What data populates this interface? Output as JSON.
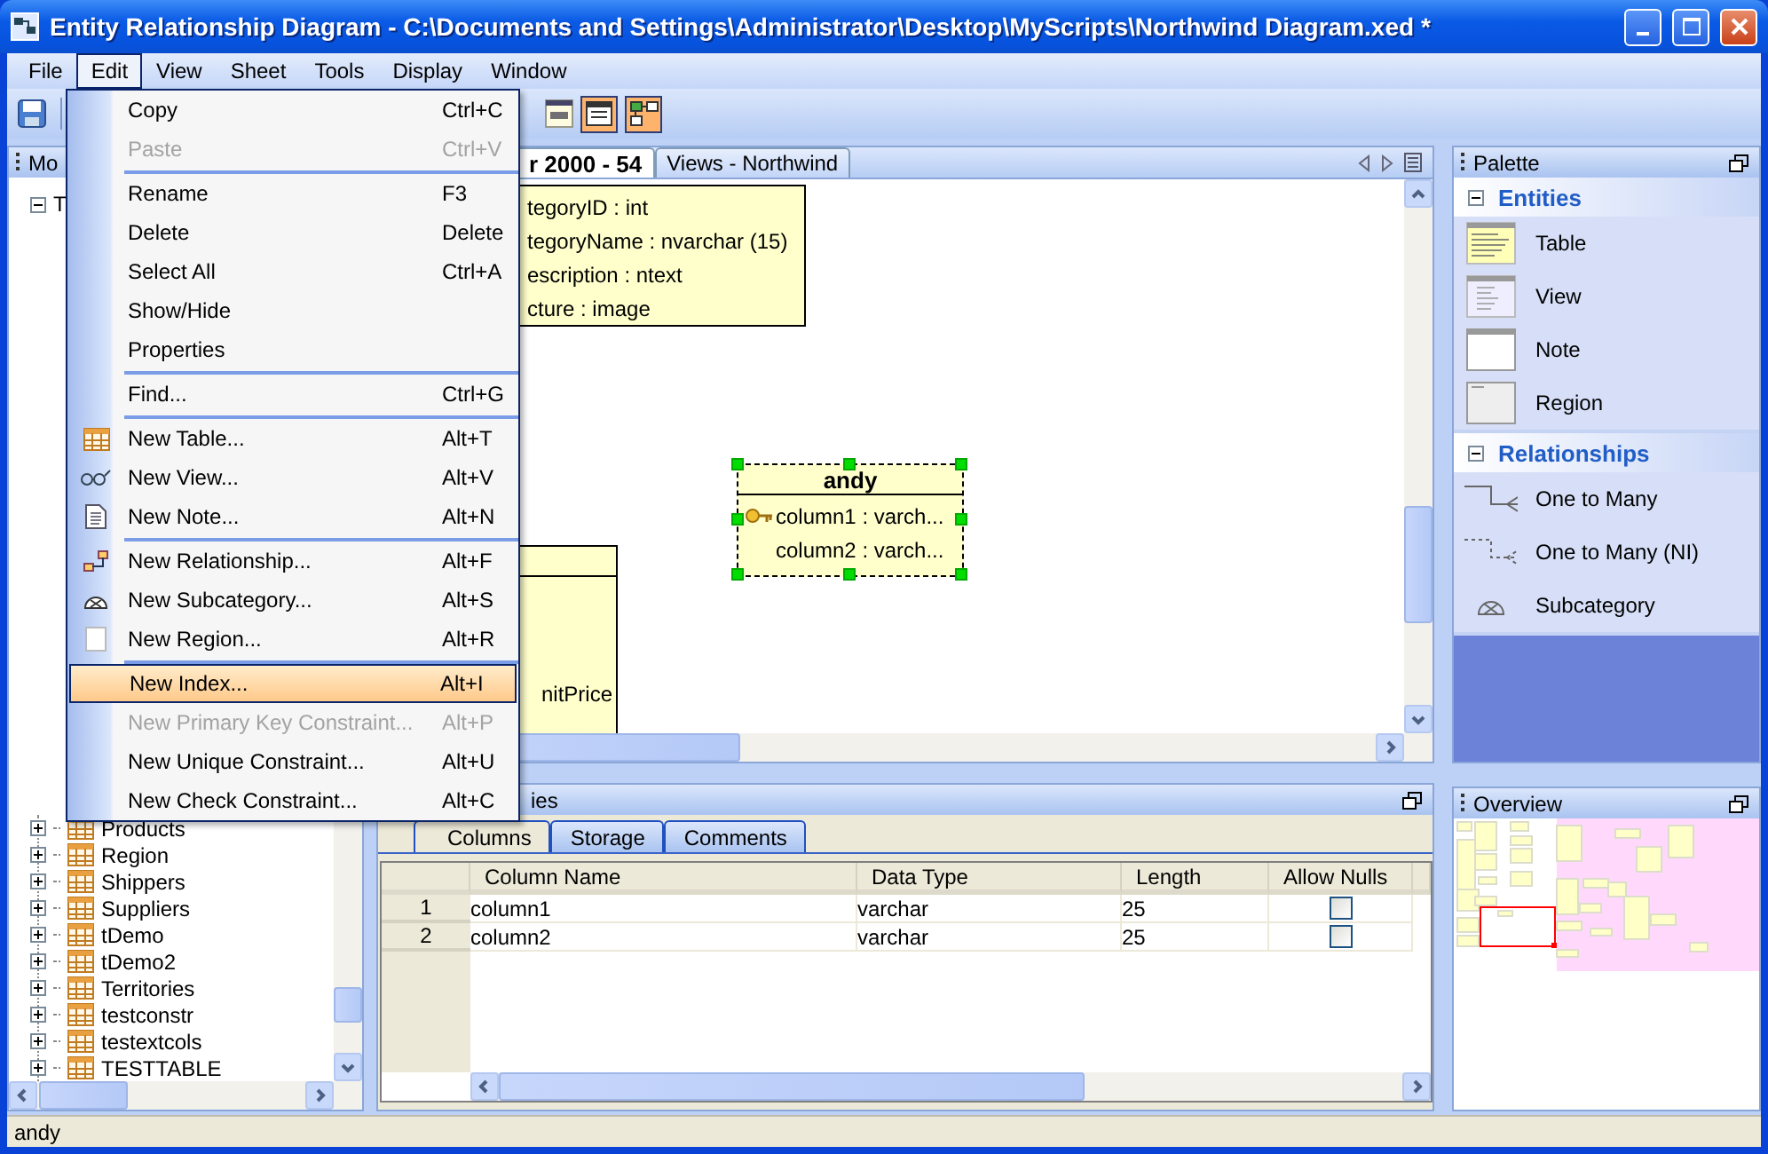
{
  "window": {
    "title": "Entity Relationship Diagram - C:\\Documents and Settings\\Administrator\\Desktop\\MyScripts\\Northwind Diagram.xed *"
  },
  "menubar": [
    {
      "label": "File",
      "selected": false
    },
    {
      "label": "Edit",
      "selected": true
    },
    {
      "label": "View",
      "selected": false
    },
    {
      "label": "Sheet",
      "selected": false
    },
    {
      "label": "Tools",
      "selected": false
    },
    {
      "label": "Display",
      "selected": false
    },
    {
      "label": "Window",
      "selected": false
    }
  ],
  "toolbar": {
    "toggles": [
      {
        "pressed": true
      },
      {
        "pressed": true
      }
    ]
  },
  "edit_menu": [
    {
      "kind": "plain",
      "label": "Copy",
      "shortcut": "Ctrl+C",
      "disabled": false,
      "selected": false
    },
    {
      "kind": "plain",
      "label": "Paste",
      "shortcut": "Ctrl+V",
      "disabled": true,
      "selected": false
    },
    {
      "kind": "separator"
    },
    {
      "kind": "plain",
      "label": "Rename",
      "shortcut": "F3",
      "disabled": false,
      "selected": false
    },
    {
      "kind": "plain",
      "label": "Delete",
      "shortcut": "Delete",
      "disabled": false,
      "selected": false
    },
    {
      "kind": "plain",
      "label": "Select All",
      "shortcut": "Ctrl+A",
      "disabled": false,
      "selected": false
    },
    {
      "kind": "plain",
      "label": "Show/Hide",
      "disabled": false,
      "selected": false
    },
    {
      "kind": "plain",
      "label": "Properties",
      "disabled": false,
      "selected": false
    },
    {
      "kind": "separator"
    },
    {
      "kind": "plain",
      "label": "Find...",
      "shortcut": "Ctrl+G",
      "disabled": false,
      "selected": false
    },
    {
      "kind": "separator"
    },
    {
      "kind": "table",
      "label": "New Table...",
      "shortcut": "Alt+T",
      "disabled": false,
      "selected": false
    },
    {
      "kind": "view",
      "label": "New View...",
      "shortcut": "Alt+V",
      "disabled": false,
      "selected": false
    },
    {
      "kind": "note",
      "label": "New Note...",
      "shortcut": "Alt+N",
      "disabled": false,
      "selected": false
    },
    {
      "kind": "separator"
    },
    {
      "kind": "relationship",
      "label": "New Relationship...",
      "shortcut": "Alt+F",
      "disabled": false,
      "selected": false
    },
    {
      "kind": "subcategory",
      "label": "New Subcategory...",
      "shortcut": "Alt+S",
      "disabled": false,
      "selected": false
    },
    {
      "kind": "region",
      "label": "New Region...",
      "shortcut": "Alt+R",
      "disabled": false,
      "selected": false
    },
    {
      "kind": "separator"
    },
    {
      "kind": "plain",
      "label": "New Index...",
      "shortcut": "Alt+I",
      "disabled": false,
      "selected": true
    },
    {
      "kind": "plain",
      "label": "New Primary Key Constraint...",
      "shortcut": "Alt+P",
      "disabled": true,
      "selected": false
    },
    {
      "kind": "plain",
      "label": "New Unique Constraint...",
      "shortcut": "Alt+U",
      "disabled": false,
      "selected": false
    },
    {
      "kind": "plain",
      "label": "New Check Constraint...",
      "shortcut": "Alt+C",
      "disabled": false,
      "selected": false
    }
  ],
  "model_panel": {
    "title": "Mo",
    "tree": {
      "label": "T",
      "expanded": true,
      "children": [
        {
          "label": "Products",
          "expanded": false
        },
        {
          "label": "Region",
          "expanded": false
        },
        {
          "label": "Shippers",
          "expanded": false
        },
        {
          "label": "Suppliers",
          "expanded": false
        },
        {
          "label": "tDemo",
          "expanded": false
        },
        {
          "label": "tDemo2",
          "expanded": false
        },
        {
          "label": "Territories",
          "expanded": false
        },
        {
          "label": "testconstr",
          "expanded": false
        },
        {
          "label": "testextcols",
          "expanded": false
        },
        {
          "label": "TESTTABLE",
          "expanded": false
        }
      ]
    }
  },
  "diagram": {
    "tabs": [
      {
        "label": "r 2000 - 54",
        "selected": true
      },
      {
        "label": "Views - Northwind",
        "selected": false
      }
    ],
    "entities": [
      {
        "selected": false,
        "columns": [
          {
            "text": "tegoryID : int",
            "key": false
          },
          {
            "text": "tegoryName : nvarchar (15)",
            "key": false
          },
          {
            "text": "escription : ntext",
            "key": false
          },
          {
            "text": "cture : image",
            "key": false
          }
        ]
      },
      {
        "selected": false,
        "columns": [
          {
            "text": "nitPrice",
            "key": false
          }
        ]
      },
      {
        "name": "andy",
        "selected": true,
        "columns": [
          {
            "text": "column1 : varch...",
            "key": true
          },
          {
            "text": "column2 : varch...",
            "key": false
          }
        ]
      }
    ]
  },
  "properties_panel": {
    "title": "ies",
    "tabs": [
      {
        "label": "Columns",
        "selected": true
      },
      {
        "label": "Storage",
        "selected": false
      },
      {
        "label": "Comments",
        "selected": false
      }
    ],
    "columns": [
      "Column Name",
      "Data Type",
      "Length",
      "Allow Nulls"
    ],
    "rows": [
      {
        "number": "1",
        "name": "column1",
        "type": "varchar",
        "length": "25",
        "allow_nulls": false
      },
      {
        "number": "2",
        "name": "column2",
        "type": "varchar",
        "length": "25",
        "allow_nulls": false
      }
    ]
  },
  "palette": {
    "title": "Palette",
    "sections": [
      {
        "title": "Entities",
        "expanded": true,
        "items": [
          {
            "label": "Table",
            "kind": "table"
          },
          {
            "label": "View",
            "kind": "view"
          },
          {
            "label": "Note",
            "kind": "note"
          },
          {
            "label": "Region",
            "kind": "region"
          }
        ]
      },
      {
        "title": "Relationships",
        "expanded": true,
        "items": [
          {
            "label": "One to Many",
            "kind": "one-to-many"
          },
          {
            "label": "One to Many (NI)",
            "kind": "one-to-many-ni"
          },
          {
            "label": "Subcategory",
            "kind": "subcategory"
          }
        ]
      }
    ]
  },
  "overview": {
    "title": "Overview"
  },
  "status_bar": {
    "text": "andy"
  }
}
